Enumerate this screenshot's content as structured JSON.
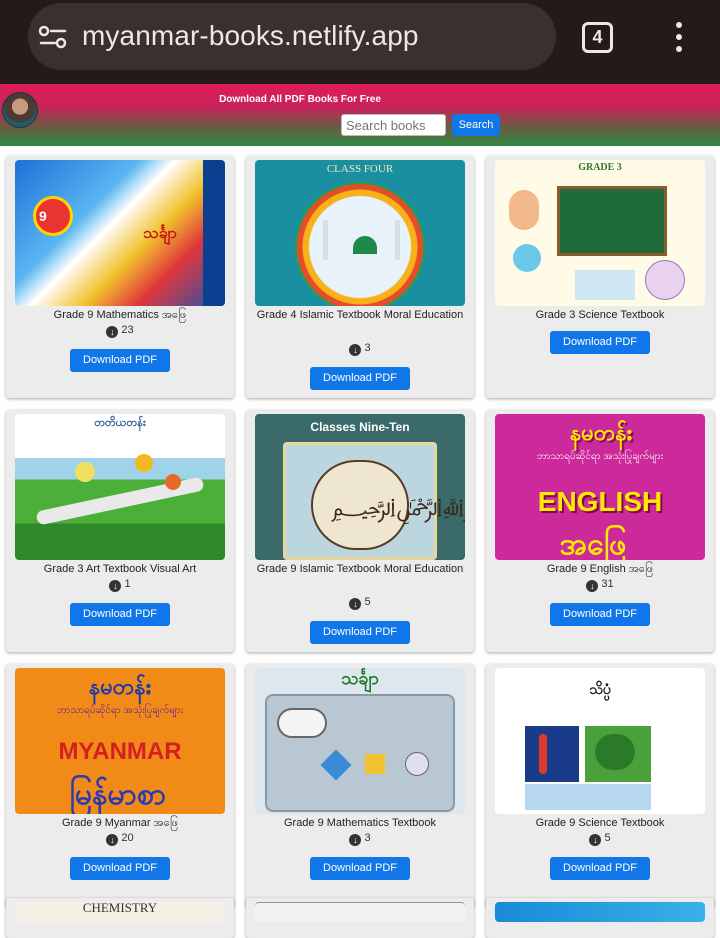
{
  "browser": {
    "url": "myanmar-books.netlify.app",
    "tab_count": "4"
  },
  "header": {
    "tagline": "Download All PDF Books For Free",
    "search_placeholder": "Search books",
    "search_button": "Search"
  },
  "download_button_label": "Download PDF",
  "books": [
    {
      "title": "Grade 9 Mathematics အဖြေ",
      "downloads": "23",
      "cover_text": "သင်္ချာ"
    },
    {
      "title": "Grade 4 Islamic Textbook Moral Education",
      "downloads": "3",
      "cover_text": "CLASS FOUR"
    },
    {
      "title": "Grade 3 Science Textbook",
      "downloads": "",
      "cover_text": "GRADE 3"
    },
    {
      "title": "Grade 3 Art Textbook Visual Art",
      "downloads": "1",
      "cover_text": "တတိယတန်း"
    },
    {
      "title": "Grade 9 Islamic Textbook Moral Education",
      "downloads": "5",
      "cover_text": "Classes Nine-Ten"
    },
    {
      "title": "Grade 9 English အဖြေ",
      "downloads": "31",
      "cover_text": "ENGLISH"
    },
    {
      "title": "Grade 9 Myanmar အဖြေ",
      "downloads": "20",
      "cover_text": "MYANMAR"
    },
    {
      "title": "Grade 9 Mathematics Textbook",
      "downloads": "3",
      "cover_text": "သင်္ချာ"
    },
    {
      "title": "Grade 9 Science Textbook",
      "downloads": "5",
      "cover_text": "သိပ္ပံ"
    }
  ],
  "partial_row": [
    {
      "cover_text": "CHEMISTRY"
    },
    {
      "cover_text": ""
    },
    {
      "cover_text": ""
    }
  ],
  "colors": {
    "chrome": "#231a1a",
    "accent": "#1176e8",
    "card": "#ececec"
  }
}
